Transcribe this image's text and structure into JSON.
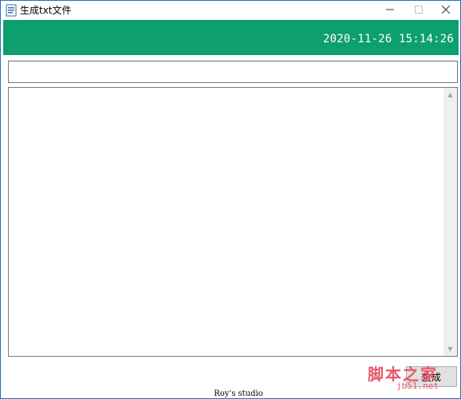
{
  "window": {
    "title": "生成txt文件",
    "min_glyph": "—",
    "max_glyph": "☐",
    "close_glyph": "✕"
  },
  "header": {
    "datetime": "2020-11-26 15:14:26",
    "color": "#0e9f6e"
  },
  "inputs": {
    "top_value": "",
    "editor_value": ""
  },
  "scrollbar": {
    "up_glyph": "▲",
    "down_glyph": "▼"
  },
  "button": {
    "label": "生成"
  },
  "footer": {
    "text": "Roy's studio"
  },
  "watermark": {
    "main": "脚本之家",
    "sub": "jb51.net",
    "color": "#e8596b"
  },
  "colors": {
    "accent": "#1a73c8"
  }
}
